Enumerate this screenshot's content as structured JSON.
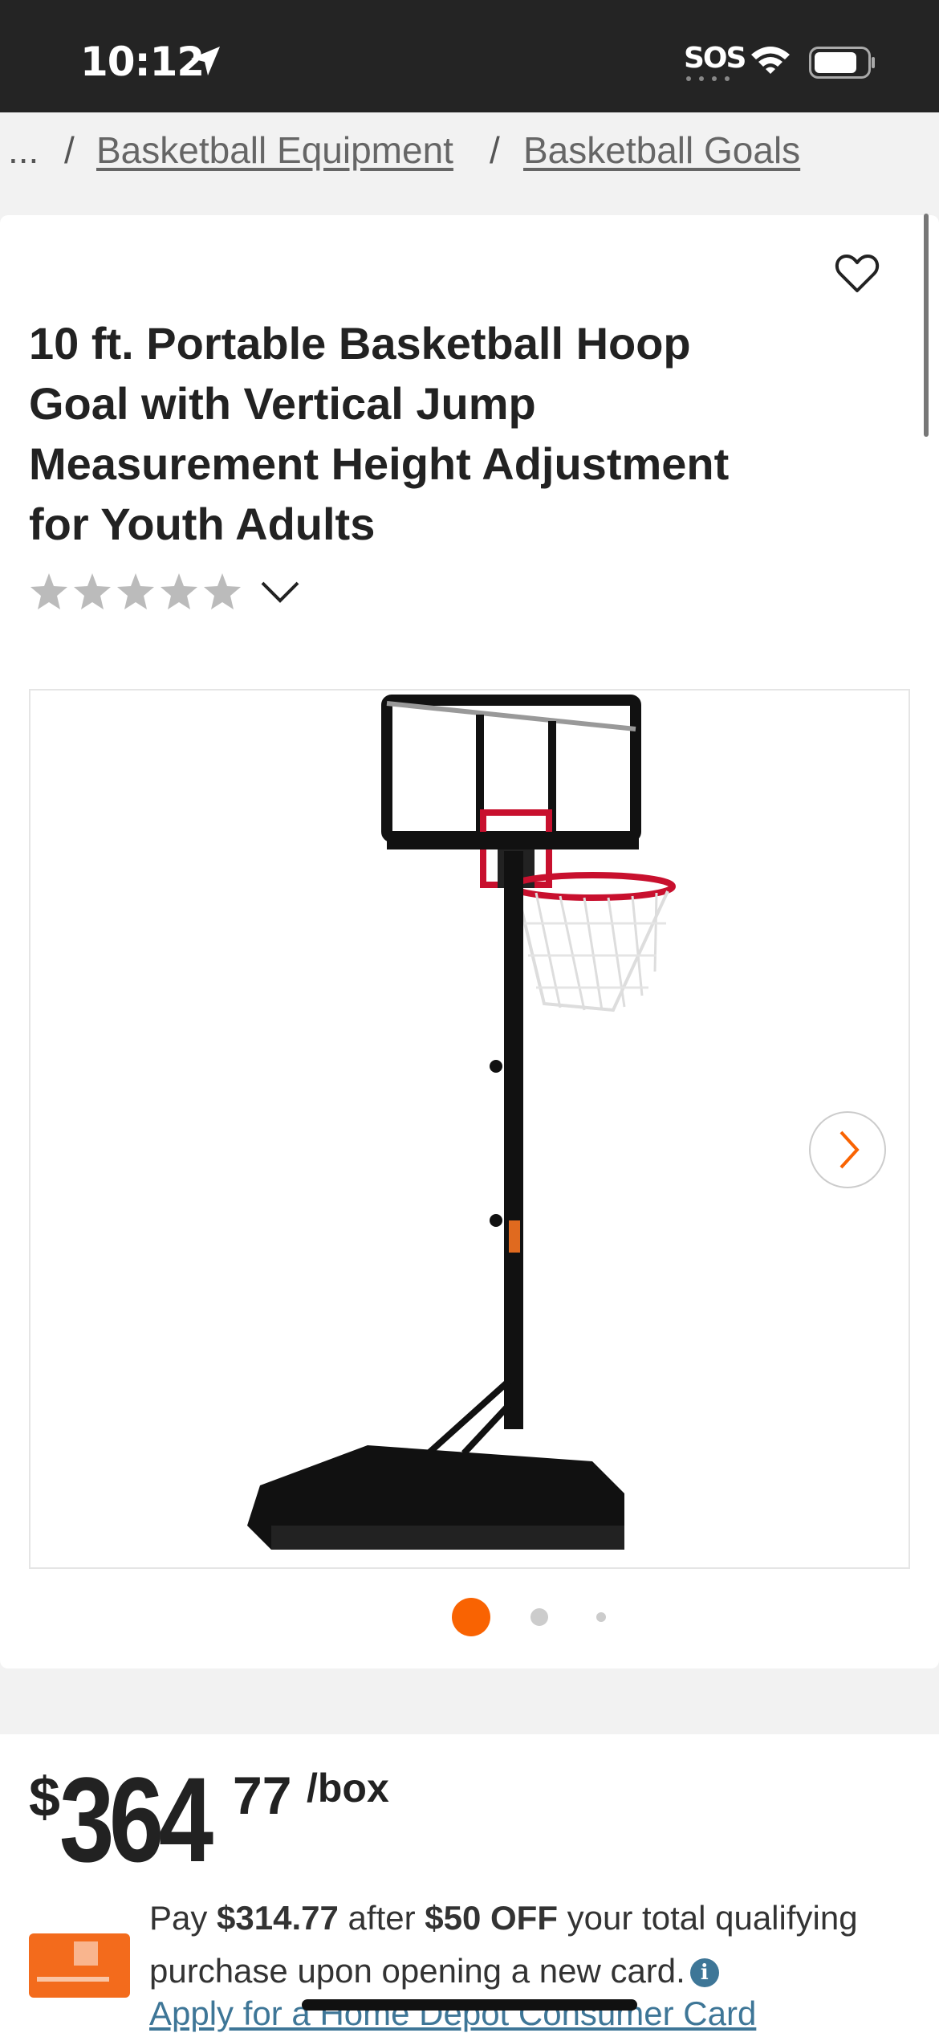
{
  "status_bar": {
    "time": "10:12",
    "sos": "SOS"
  },
  "breadcrumb": {
    "ellipsis": "...",
    "sep": "/",
    "item1": "Basketball Equipment",
    "item2": "Basketball Goals"
  },
  "product": {
    "title": "10 ft. Portable Basketball Hoop Goal with Vertical Jump Measurement Height Adjustment for Youth Adults",
    "rating": 0,
    "stars_max": 5
  },
  "gallery": {
    "image_count": 3,
    "active_index": 0
  },
  "price": {
    "dollar_sign": "$",
    "whole": "364",
    "cents": "77",
    "unit": "/box"
  },
  "promo": {
    "pay": "Pay ",
    "amount": "$314.77",
    "after": " after ",
    "off": "$50 OFF",
    "rest": " your total qualifying purchase upon opening a new card.",
    "info": "i",
    "apply_link": "Apply for a Home Depot Consumer Card"
  },
  "colors": {
    "accent": "#f96302",
    "link": "#3e7697",
    "status_bar": "#242424"
  }
}
